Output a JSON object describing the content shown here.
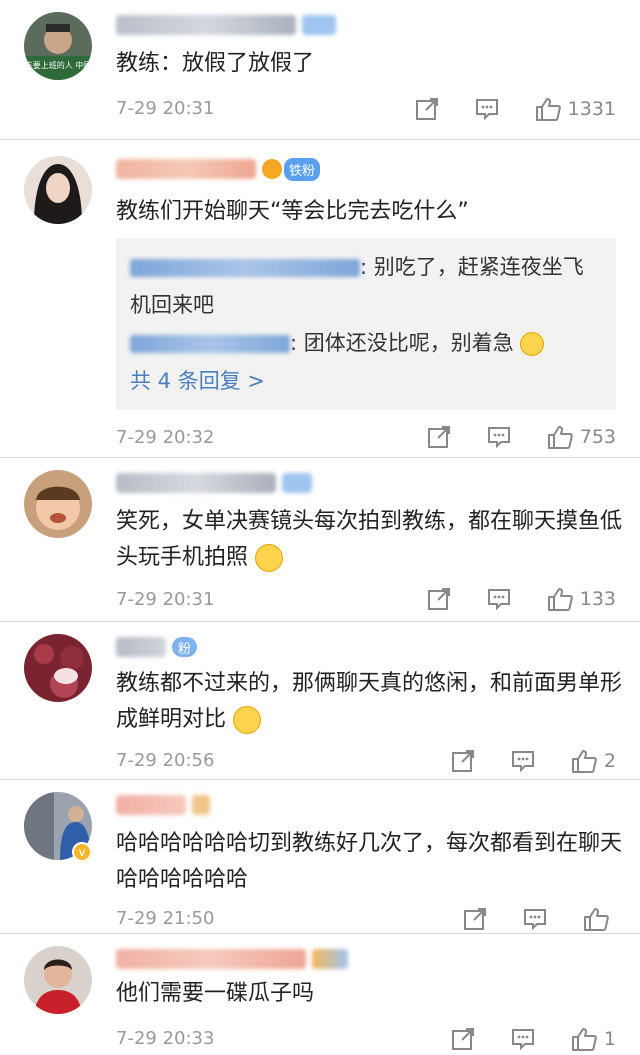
{
  "comments": [
    {
      "text": "教练：放假了放假了",
      "time": "7-29 20:31",
      "likes": "1331"
    },
    {
      "text": "教练们开始聊天“等会比完去吃什么”",
      "time": "7-29 20:32",
      "likes": "753",
      "fan_badge": "铁粉",
      "replies": [
        {
          "text": ": 别吃了，赶紧连夜坐飞机回来吧"
        },
        {
          "text": ": 团体还没比呢，别着急"
        }
      ],
      "more_replies": "共 4 条回复 >"
    },
    {
      "text": "笑死，女单决赛镜头每次拍到教练，都在聊天摸鱼低头玩手机拍照",
      "time": "7-29 20:31",
      "likes": "133"
    },
    {
      "text": "教练都不过来的，那俩聊天真的悠闲，和前面男单形成鲜明对比",
      "time": "7-29 20:56",
      "likes": "2",
      "badge": "粉"
    },
    {
      "text": "哈哈哈哈哈哈切到教练好几次了，每次都看到在聊天哈哈哈哈哈哈",
      "time": "7-29 21:50",
      "likes": ""
    },
    {
      "text": "他们需要一碟瓜子吗",
      "time": "7-29 20:33",
      "likes": "1"
    }
  ],
  "avatar_caption": "不要上班的人 中國",
  "icons": [
    "share-icon",
    "comment-icon",
    "like-icon",
    "laugh-emoji-icon"
  ],
  "colors": {
    "link": "#4a7ebd",
    "time": "#999999",
    "text": "#222222"
  }
}
